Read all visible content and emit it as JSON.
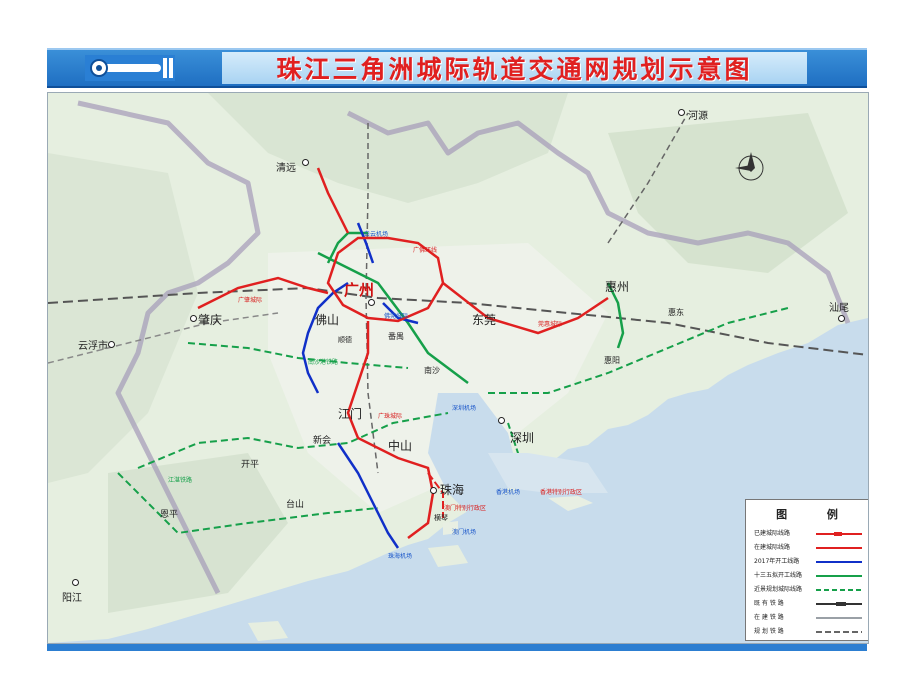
{
  "title": "珠江三角洲城际轨道交通网规划示意图",
  "colors": {
    "header_blue": "#2c7ed1",
    "title_red": "#e02020",
    "built_line": "#e02020",
    "under_construction": "#e02020",
    "start_2017": "#1030c8",
    "start_13th_plan": "#16a04a",
    "planned_recent": "#16a04a",
    "existing_rail": "#333333",
    "rail_construction": "#9aa0a6",
    "planned_rail": "#666666",
    "sea": "#c8dcec",
    "land": "#e8f0e2"
  },
  "cities": {
    "guangzhou": "广州",
    "foshan": "佛山",
    "dongguan": "东莞",
    "shenzhen": "深圳",
    "zhuhai": "珠海",
    "zhongshan": "中山",
    "jiangmen": "江门",
    "zhaoqing": "肇庆",
    "huizhou": "惠州",
    "qingyuan": "清远",
    "heyuan": "河源",
    "shanwei": "汕尾",
    "yunfu": "云浮市",
    "yangjiang": "阳江",
    "kaiping": "开平",
    "taishan": "台山",
    "xinhui": "新会",
    "enping": "恩平",
    "panyu": "番禺",
    "nansha": "南沙",
    "huidong": "惠东",
    "huiyang": "惠阳",
    "hengqin": "横琴",
    "shunde": "顺德"
  },
  "map_labels": {
    "hk": "香港特别行政区",
    "macau": "澳门特别行政区",
    "airport_bai": "白云机场",
    "airport_zh": "珠海机场",
    "airport_sz": "深圳机场",
    "airport_hk": "香港机场",
    "airport_mo": "澳门机场",
    "line_guangfo": "广佛环线",
    "line_guanhui": "莞惠城际",
    "line_guangzhu": "广珠城际",
    "line_guangzhao": "广肇城际",
    "line_foguan": "佛莞城际",
    "line_jiangzhan": "江湛铁路",
    "line_nansha": "南沙港铁路"
  },
  "legend": {
    "title": "图 例",
    "items": [
      {
        "label": "已建城际线路",
        "style": "built"
      },
      {
        "label": "在建城际线路",
        "style": "construction"
      },
      {
        "label": "2017年开工线路",
        "style": "start2017"
      },
      {
        "label": "十三五拟开工线路",
        "style": "start13"
      },
      {
        "label": "近景规划城际线路",
        "style": "planned"
      },
      {
        "label": "既 有 铁 路",
        "style": "rail"
      },
      {
        "label": "在 建 铁 路",
        "style": "railc"
      },
      {
        "label": "规 划 铁 路",
        "style": "railp"
      }
    ]
  }
}
